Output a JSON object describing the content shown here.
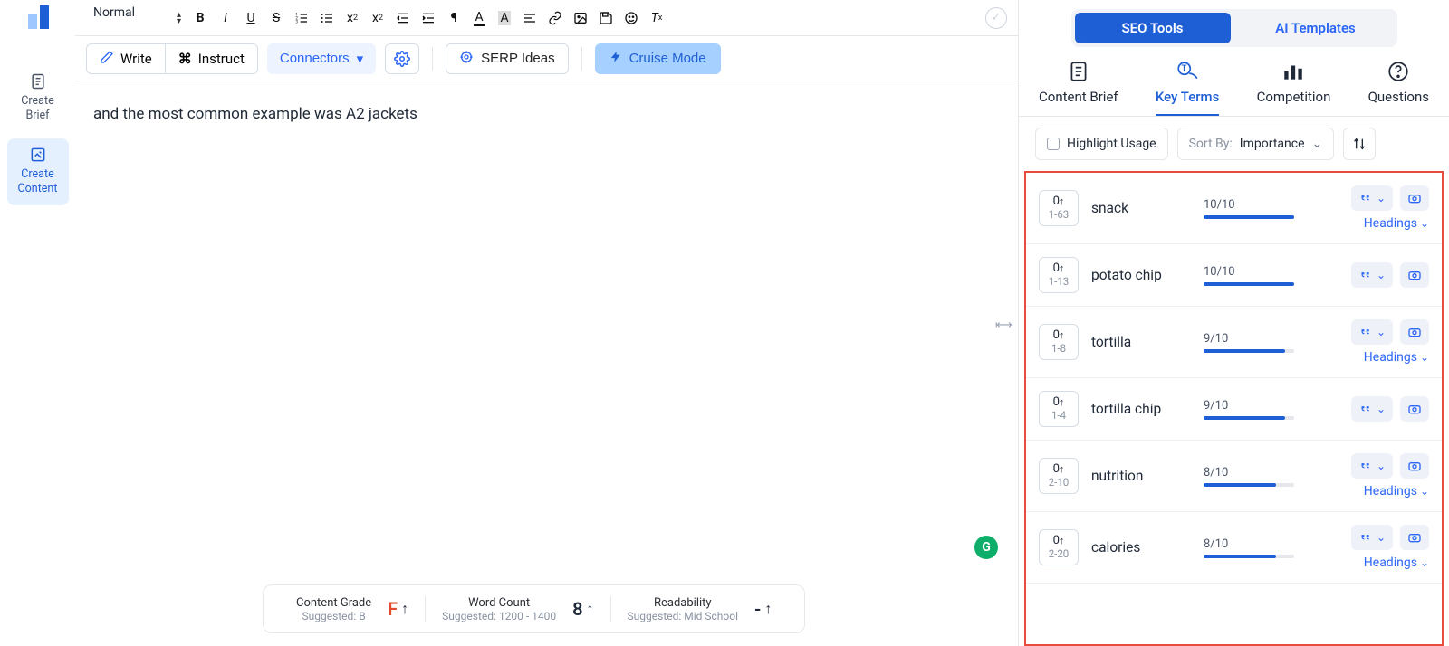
{
  "leftrail": {
    "items": [
      {
        "label": "Create Brief",
        "active": false
      },
      {
        "label": "Create Content",
        "active": true
      }
    ]
  },
  "fmt": {
    "paragraph_style": "Normal"
  },
  "actions": {
    "write": "Write",
    "instruct": "Instruct",
    "connectors": "Connectors",
    "serp": "SERP Ideas",
    "cruise": "Cruise Mode"
  },
  "editor": {
    "content": "and the most common example was A2 jackets"
  },
  "metrics": {
    "grade": {
      "title": "Content Grade",
      "sub": "Suggested: B",
      "value": "F"
    },
    "words": {
      "title": "Word Count",
      "sub": "Suggested: 1200 - 1400",
      "value": "8"
    },
    "read": {
      "title": "Readability",
      "sub": "Suggested: Mid School",
      "value": "-"
    }
  },
  "right": {
    "pills": {
      "seo": "SEO Tools",
      "ai": "AI Templates"
    },
    "subtabs": {
      "brief": "Content Brief",
      "key": "Key Terms",
      "comp": "Competition",
      "q": "Questions"
    },
    "highlight": "Highlight Usage",
    "sort_label": "Sort By:",
    "sort_value": "Importance",
    "headings_label": "Headings",
    "terms": [
      {
        "count": "0",
        "range": "1-63",
        "name": "snack",
        "score": "10/10",
        "fill": 100,
        "headings": true
      },
      {
        "count": "0",
        "range": "1-13",
        "name": "potato chip",
        "score": "10/10",
        "fill": 100,
        "headings": false
      },
      {
        "count": "0",
        "range": "1-8",
        "name": "tortilla",
        "score": "9/10",
        "fill": 90,
        "headings": true
      },
      {
        "count": "0",
        "range": "1-4",
        "name": "tortilla chip",
        "score": "9/10",
        "fill": 90,
        "headings": false
      },
      {
        "count": "0",
        "range": "2-10",
        "name": "nutrition",
        "score": "8/10",
        "fill": 80,
        "headings": true
      },
      {
        "count": "0",
        "range": "2-20",
        "name": "calories",
        "score": "8/10",
        "fill": 80,
        "headings": true
      }
    ]
  }
}
